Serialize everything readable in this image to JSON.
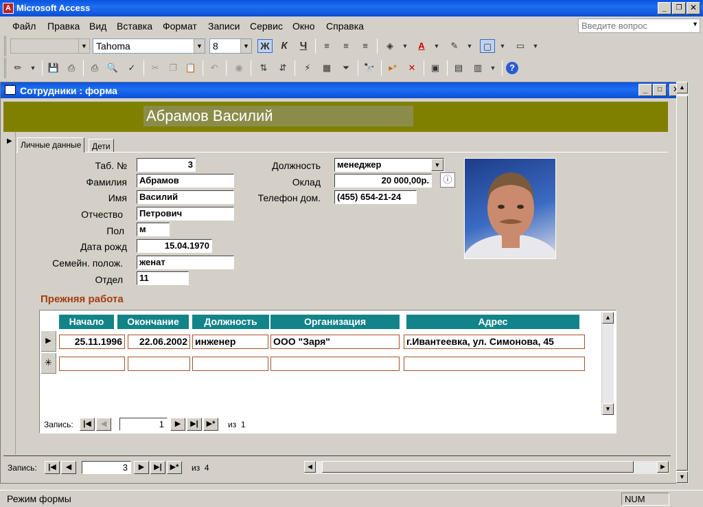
{
  "app": {
    "title": "Microsoft Access"
  },
  "menu": {
    "items": [
      "Файл",
      "Правка",
      "Вид",
      "Вставка",
      "Формат",
      "Записи",
      "Сервис",
      "Окно",
      "Справка"
    ],
    "help_placeholder": "Введите вопрос"
  },
  "format_toolbar": {
    "font": "Tahoma",
    "font_size": "8",
    "bold_label": "Ж",
    "italic_label": "К",
    "underline_label": "Ч"
  },
  "window": {
    "title": "Сотрудники : форма"
  },
  "header": {
    "name": "Абрамов  Василий"
  },
  "tabs": [
    {
      "label": "Личные данные",
      "active": true
    },
    {
      "label": "Дети",
      "active": false
    }
  ],
  "fields": {
    "tab_no": {
      "label": "Таб. №",
      "value": "3"
    },
    "last_name": {
      "label": "Фамилия",
      "value": "Абрамов"
    },
    "first_name": {
      "label": "Имя",
      "value": "Василий"
    },
    "patronymic": {
      "label": "Отчество",
      "value": "Петрович"
    },
    "gender": {
      "label": "Пол",
      "value": "м"
    },
    "birth_date": {
      "label": "Дата рожд",
      "value": "15.04.1970"
    },
    "marital": {
      "label": "Семейн. полож.",
      "value": "женат"
    },
    "department": {
      "label": "Отдел",
      "value": "11"
    },
    "position": {
      "label": "Должность",
      "value": "менеджер"
    },
    "salary": {
      "label": "Оклад",
      "value": "20 000,00р."
    },
    "phone": {
      "label": "Телефон дом.",
      "value": "(455) 654-21-24"
    }
  },
  "subform": {
    "title": "Прежняя работа",
    "columns": [
      "Начало",
      "Окончание",
      "Должность",
      "Организация",
      "Адрес"
    ],
    "rows": [
      [
        "25.11.1996",
        "22.06.2002",
        "инженер",
        "ООО \"Заря\"",
        "г.Ивантеевка, ул. Симонова, 45"
      ]
    ],
    "nav": {
      "label": "Запись:",
      "current": "1",
      "of_label": "из",
      "total": "1"
    }
  },
  "main_nav": {
    "label": "Запись:",
    "current": "3",
    "of_label": "из",
    "total": "4"
  },
  "status": {
    "mode": "Режим формы",
    "num": "NUM"
  },
  "colors": {
    "header_band": "#808000",
    "column_header": "#13838a",
    "section_title": "#a33c10",
    "titlebar": "#0a54e0"
  }
}
